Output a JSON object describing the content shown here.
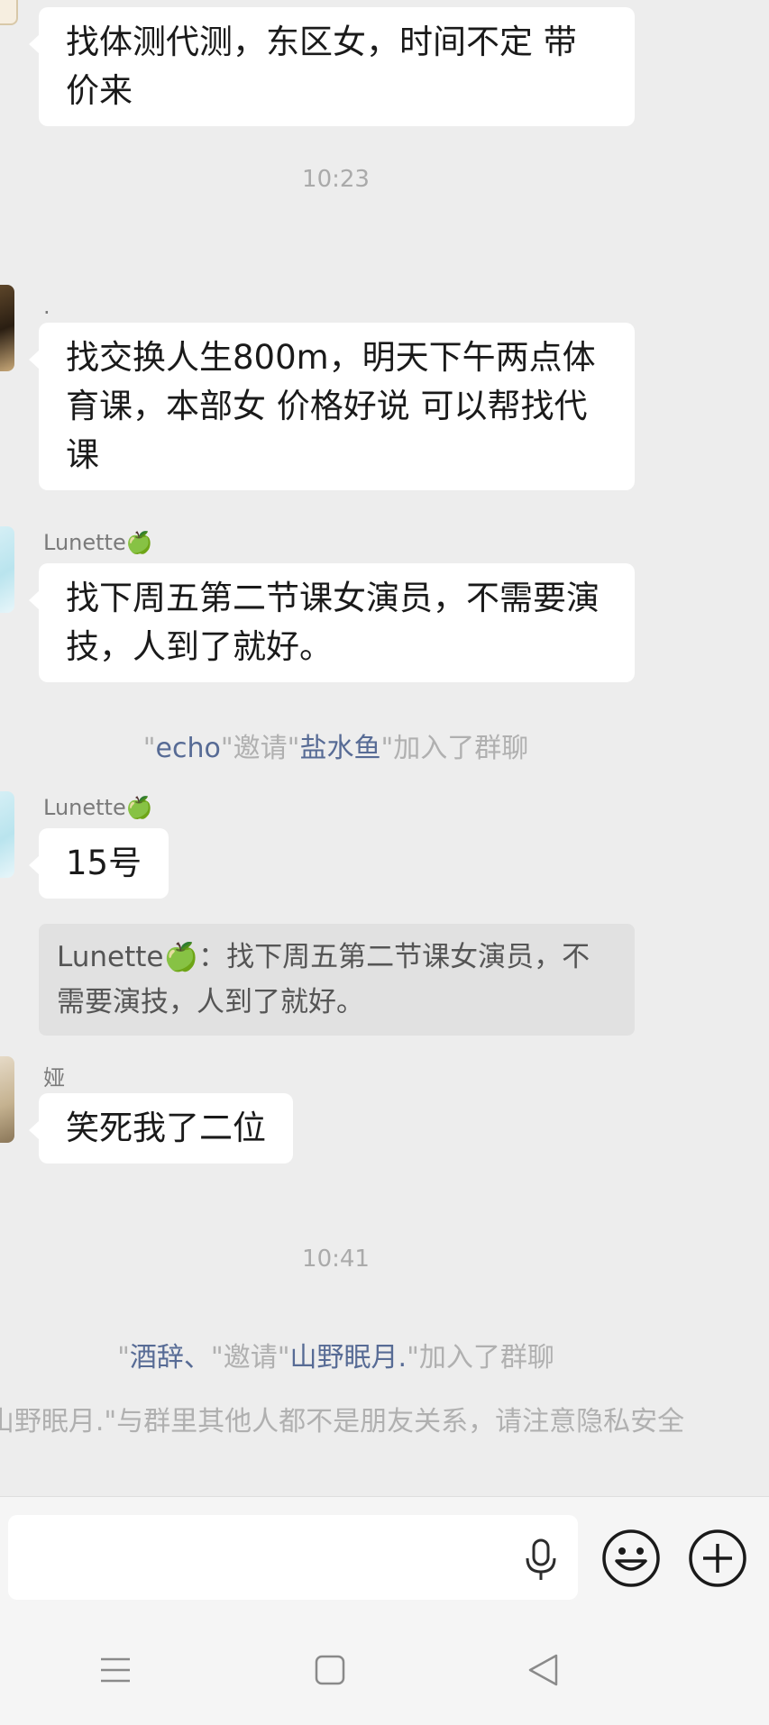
{
  "messages": [
    {
      "sender": "",
      "text": "找体测代测，东区女，时间不定 带价来"
    },
    {
      "sender": ".",
      "text": "找交换人生800m，明天下午两点体育课，本部女  价格好说 可以帮找代课"
    },
    {
      "sender": "Lunette",
      "text": "找下周五第二节课女演员，不需要演技，人到了就好。"
    },
    {
      "sender": "Lunette",
      "text": "15号"
    },
    {
      "sender": "娅",
      "text": "笑死我了二位"
    }
  ],
  "quote": {
    "text": "Lunette🍏：找下周五第二节课女演员，不需要演技，人到了就好。"
  },
  "timestamps": [
    "10:23",
    "10:41"
  ],
  "system_messages": [
    {
      "q1": "\"",
      "name1": "echo",
      "q2": "\"邀请\"",
      "name2": "盐水鱼",
      "q3": "\"加入了群聊"
    },
    {
      "q1": "\"",
      "name1": "酒辞、",
      "q2": "\"邀请\"",
      "name2": "山野眠月.",
      "q3": "\"加入了群聊"
    }
  ],
  "privacy_notice": "山野眠月.\"与群里其他人都不是朋友关系，请注意隐私安全",
  "sender_emoji": "🍏",
  "icons": {
    "voice": "microphone-icon",
    "emoji": "smiley-icon",
    "more": "plus-circle-icon",
    "nav_menu": "menu-icon",
    "nav_home": "square-icon",
    "nav_back": "triangle-back-icon"
  },
  "colors": {
    "background": "#ededed",
    "bubble": "#ffffff",
    "link_name": "#576b95",
    "system_text": "#b0b0b0"
  }
}
